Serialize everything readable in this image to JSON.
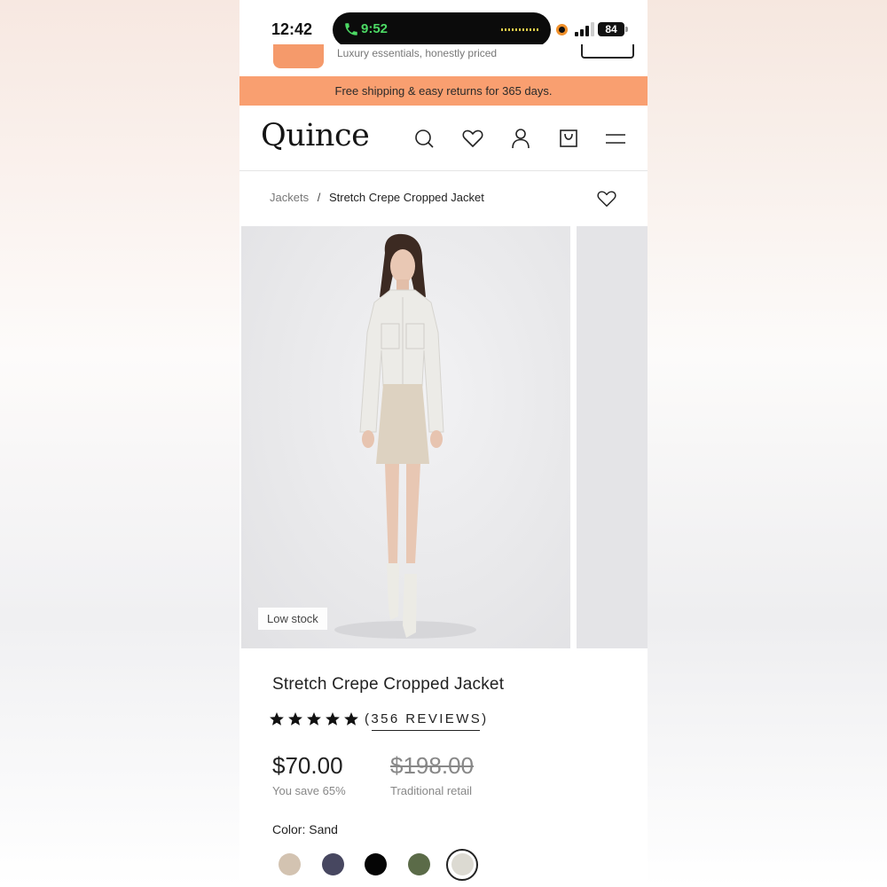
{
  "status_bar": {
    "time": "12:42",
    "call_time": "9:52",
    "battery": "84"
  },
  "peek": {
    "text": "Luxury essentials, honestly priced"
  },
  "promo": {
    "text": "Free shipping & easy returns for 365 days."
  },
  "nav": {
    "logo": "Quince",
    "icons": [
      "search-icon",
      "heart-icon",
      "account-icon",
      "cart-icon",
      "menu-icon"
    ]
  },
  "breadcrumb": {
    "parent": "Jackets",
    "separator": "/",
    "current": "Stretch Crepe Cropped Jacket"
  },
  "gallery": {
    "badge": "Low stock"
  },
  "product": {
    "title": "Stretch Crepe Cropped Jacket",
    "rating_stars": 5,
    "reviews_label": "(356 REVIEWS)",
    "price": "$70.00",
    "savings": "You save 65%",
    "traditional_price": "$198.00",
    "traditional_label": "Traditional retail",
    "color_label": "Color:",
    "color_name": "Sand",
    "swatches": [
      {
        "name": "tan",
        "color": "#d3c3b1"
      },
      {
        "name": "navy",
        "color": "#474760"
      },
      {
        "name": "black",
        "color": "#050505"
      },
      {
        "name": "olive",
        "color": "#5b6b48"
      },
      {
        "name": "sand",
        "color": "#dcdad2",
        "selected": true
      }
    ]
  },
  "colors": {
    "accent": "#f99f70",
    "text": "#222222"
  }
}
